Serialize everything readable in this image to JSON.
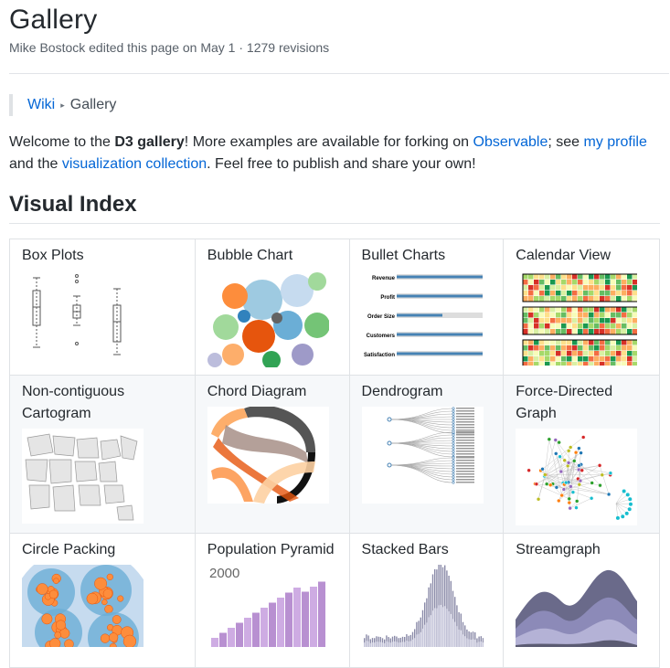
{
  "page": {
    "title": "Gallery",
    "meta": "Mike Bostock edited this page on May 1 · 1279 revisions"
  },
  "breadcrumb": {
    "root": "Wiki",
    "current": "Gallery"
  },
  "intro": {
    "p1": "Welcome to the ",
    "strong": "D3 gallery",
    "p2": "! More examples are available for forking on ",
    "link_observable": "Observable",
    "p3": "; see ",
    "link_profile": "my profile",
    "p4": " and the ",
    "link_collection": "visualization collection",
    "p5": ". Feel free to publish and share your own!"
  },
  "section": {
    "heading": "Visual Index"
  },
  "gallery": [
    {
      "label": "Box Plots",
      "icon": "box-plot-thumbnail"
    },
    {
      "label": "Bubble Chart",
      "icon": "bubble-chart-thumbnail"
    },
    {
      "label": "Bullet Charts",
      "icon": "bullet-chart-thumbnail"
    },
    {
      "label": "Calendar View",
      "icon": "calendar-view-thumbnail"
    },
    {
      "label": "Non-contiguous Cartogram",
      "icon": "cartogram-thumbnail"
    },
    {
      "label": "Chord Diagram",
      "icon": "chord-diagram-thumbnail"
    },
    {
      "label": "Dendrogram",
      "icon": "dendrogram-thumbnail"
    },
    {
      "label": "Force-Directed Graph",
      "icon": "force-graph-thumbnail"
    },
    {
      "label": "Circle Packing",
      "icon": "circle-packing-thumbnail"
    },
    {
      "label": "Population Pyramid",
      "icon": "population-pyramid-thumbnail"
    },
    {
      "label": "Stacked Bars",
      "icon": "stacked-bars-thumbnail"
    },
    {
      "label": "Streamgraph",
      "icon": "streamgraph-thumbnail"
    }
  ],
  "thumbs": {
    "bullet_labels": [
      "Revenue",
      "Profit",
      "Order Size",
      "Customers",
      "Satisfaction"
    ],
    "pyramid_year": "2000"
  },
  "colors": {
    "link": "#0366d6",
    "border": "#dfe2e5",
    "alt_row": "#f6f8fa",
    "text": "#24292e"
  }
}
